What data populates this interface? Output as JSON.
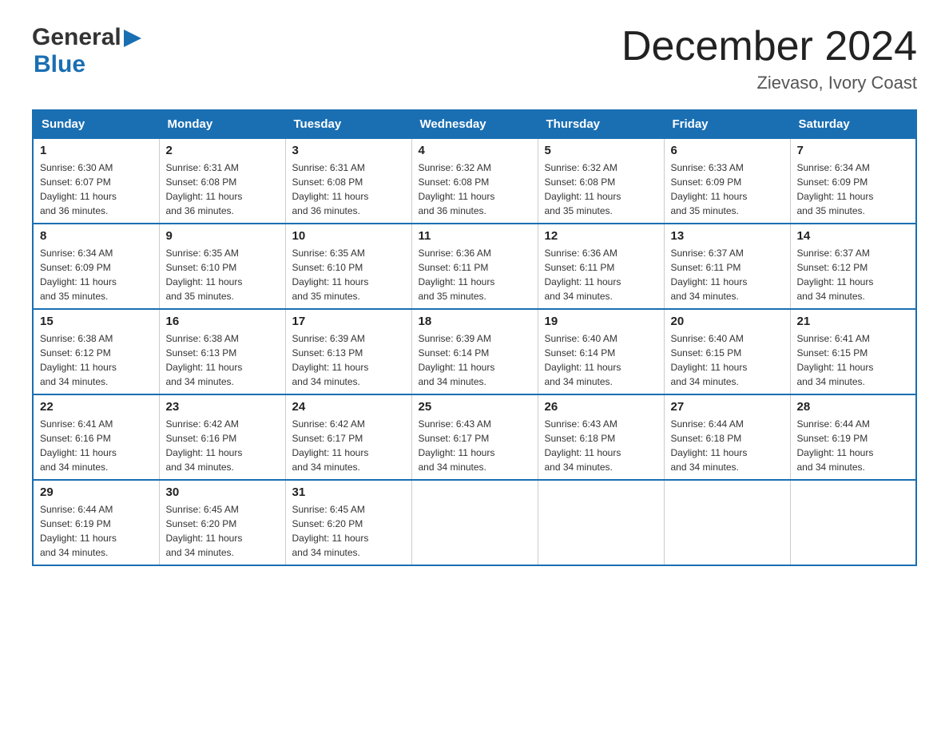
{
  "header": {
    "logo_general": "General",
    "logo_blue": "Blue",
    "month_title": "December 2024",
    "location": "Zievaso, Ivory Coast"
  },
  "days_of_week": [
    "Sunday",
    "Monday",
    "Tuesday",
    "Wednesday",
    "Thursday",
    "Friday",
    "Saturday"
  ],
  "weeks": [
    [
      {
        "day": "1",
        "sunrise": "6:30 AM",
        "sunset": "6:07 PM",
        "daylight": "11 hours and 36 minutes."
      },
      {
        "day": "2",
        "sunrise": "6:31 AM",
        "sunset": "6:08 PM",
        "daylight": "11 hours and 36 minutes."
      },
      {
        "day": "3",
        "sunrise": "6:31 AM",
        "sunset": "6:08 PM",
        "daylight": "11 hours and 36 minutes."
      },
      {
        "day": "4",
        "sunrise": "6:32 AM",
        "sunset": "6:08 PM",
        "daylight": "11 hours and 36 minutes."
      },
      {
        "day": "5",
        "sunrise": "6:32 AM",
        "sunset": "6:08 PM",
        "daylight": "11 hours and 35 minutes."
      },
      {
        "day": "6",
        "sunrise": "6:33 AM",
        "sunset": "6:09 PM",
        "daylight": "11 hours and 35 minutes."
      },
      {
        "day": "7",
        "sunrise": "6:34 AM",
        "sunset": "6:09 PM",
        "daylight": "11 hours and 35 minutes."
      }
    ],
    [
      {
        "day": "8",
        "sunrise": "6:34 AM",
        "sunset": "6:09 PM",
        "daylight": "11 hours and 35 minutes."
      },
      {
        "day": "9",
        "sunrise": "6:35 AM",
        "sunset": "6:10 PM",
        "daylight": "11 hours and 35 minutes."
      },
      {
        "day": "10",
        "sunrise": "6:35 AM",
        "sunset": "6:10 PM",
        "daylight": "11 hours and 35 minutes."
      },
      {
        "day": "11",
        "sunrise": "6:36 AM",
        "sunset": "6:11 PM",
        "daylight": "11 hours and 35 minutes."
      },
      {
        "day": "12",
        "sunrise": "6:36 AM",
        "sunset": "6:11 PM",
        "daylight": "11 hours and 34 minutes."
      },
      {
        "day": "13",
        "sunrise": "6:37 AM",
        "sunset": "6:11 PM",
        "daylight": "11 hours and 34 minutes."
      },
      {
        "day": "14",
        "sunrise": "6:37 AM",
        "sunset": "6:12 PM",
        "daylight": "11 hours and 34 minutes."
      }
    ],
    [
      {
        "day": "15",
        "sunrise": "6:38 AM",
        "sunset": "6:12 PM",
        "daylight": "11 hours and 34 minutes."
      },
      {
        "day": "16",
        "sunrise": "6:38 AM",
        "sunset": "6:13 PM",
        "daylight": "11 hours and 34 minutes."
      },
      {
        "day": "17",
        "sunrise": "6:39 AM",
        "sunset": "6:13 PM",
        "daylight": "11 hours and 34 minutes."
      },
      {
        "day": "18",
        "sunrise": "6:39 AM",
        "sunset": "6:14 PM",
        "daylight": "11 hours and 34 minutes."
      },
      {
        "day": "19",
        "sunrise": "6:40 AM",
        "sunset": "6:14 PM",
        "daylight": "11 hours and 34 minutes."
      },
      {
        "day": "20",
        "sunrise": "6:40 AM",
        "sunset": "6:15 PM",
        "daylight": "11 hours and 34 minutes."
      },
      {
        "day": "21",
        "sunrise": "6:41 AM",
        "sunset": "6:15 PM",
        "daylight": "11 hours and 34 minutes."
      }
    ],
    [
      {
        "day": "22",
        "sunrise": "6:41 AM",
        "sunset": "6:16 PM",
        "daylight": "11 hours and 34 minutes."
      },
      {
        "day": "23",
        "sunrise": "6:42 AM",
        "sunset": "6:16 PM",
        "daylight": "11 hours and 34 minutes."
      },
      {
        "day": "24",
        "sunrise": "6:42 AM",
        "sunset": "6:17 PM",
        "daylight": "11 hours and 34 minutes."
      },
      {
        "day": "25",
        "sunrise": "6:43 AM",
        "sunset": "6:17 PM",
        "daylight": "11 hours and 34 minutes."
      },
      {
        "day": "26",
        "sunrise": "6:43 AM",
        "sunset": "6:18 PM",
        "daylight": "11 hours and 34 minutes."
      },
      {
        "day": "27",
        "sunrise": "6:44 AM",
        "sunset": "6:18 PM",
        "daylight": "11 hours and 34 minutes."
      },
      {
        "day": "28",
        "sunrise": "6:44 AM",
        "sunset": "6:19 PM",
        "daylight": "11 hours and 34 minutes."
      }
    ],
    [
      {
        "day": "29",
        "sunrise": "6:44 AM",
        "sunset": "6:19 PM",
        "daylight": "11 hours and 34 minutes."
      },
      {
        "day": "30",
        "sunrise": "6:45 AM",
        "sunset": "6:20 PM",
        "daylight": "11 hours and 34 minutes."
      },
      {
        "day": "31",
        "sunrise": "6:45 AM",
        "sunset": "6:20 PM",
        "daylight": "11 hours and 34 minutes."
      },
      null,
      null,
      null,
      null
    ]
  ],
  "labels": {
    "sunrise": "Sunrise:",
    "sunset": "Sunset:",
    "daylight": "Daylight:"
  },
  "colors": {
    "header_bg": "#1a6fb3",
    "border": "#1a6fb3"
  }
}
